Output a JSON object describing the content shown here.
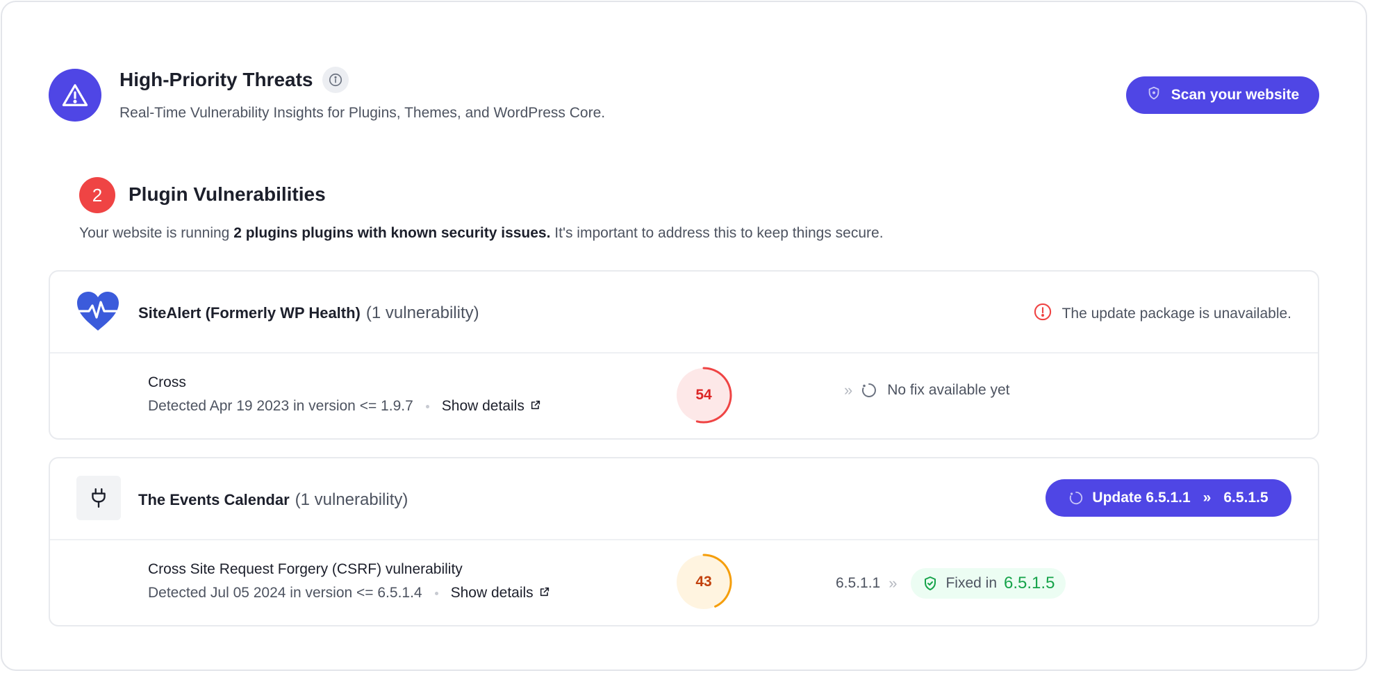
{
  "header": {
    "title": "High-Priority Threats",
    "subtitle": "Real-Time Vulnerability Insights for Plugins, Themes, and WordPress Core.",
    "scan_label": "Scan your website"
  },
  "section": {
    "count": "2",
    "title": "Plugin Vulnerabilities",
    "desc_prefix": "Your website is running",
    "desc_bold": "2 plugins plugins with known security issues.",
    "desc_suffix": "It's important to address this to keep things secure."
  },
  "plugins": [
    {
      "name": "SiteAlert (Formerly WP Health)",
      "vuln_count": "(1 vulnerability)",
      "status_text": "The update package is unavailable.",
      "vuln": {
        "title": "Cross",
        "detected": "Detected Apr 19 2023 in version <= 1.9.7",
        "details_label": "Show details",
        "score": "54",
        "score_value": 54,
        "fix_text": "No fix available yet"
      }
    },
    {
      "name": "The Events Calendar",
      "vuln_count": "(1 vulnerability)",
      "update_from": "Update 6.5.1.1",
      "update_to": "6.5.1.5",
      "vuln": {
        "title": "Cross Site Request Forgery (CSRF) vulnerability",
        "detected": "Detected Jul 05 2024 in version <= 6.5.1.4",
        "details_label": "Show details",
        "score": "43",
        "score_value": 43,
        "current_version": "6.5.1.1",
        "fixed_label": "Fixed in",
        "fixed_version": "6.5.1.5"
      }
    }
  ],
  "colors": {
    "accent": "#4f46e5",
    "danger": "#ef4444",
    "warning": "#f59e0b",
    "success": "#16a34a"
  }
}
